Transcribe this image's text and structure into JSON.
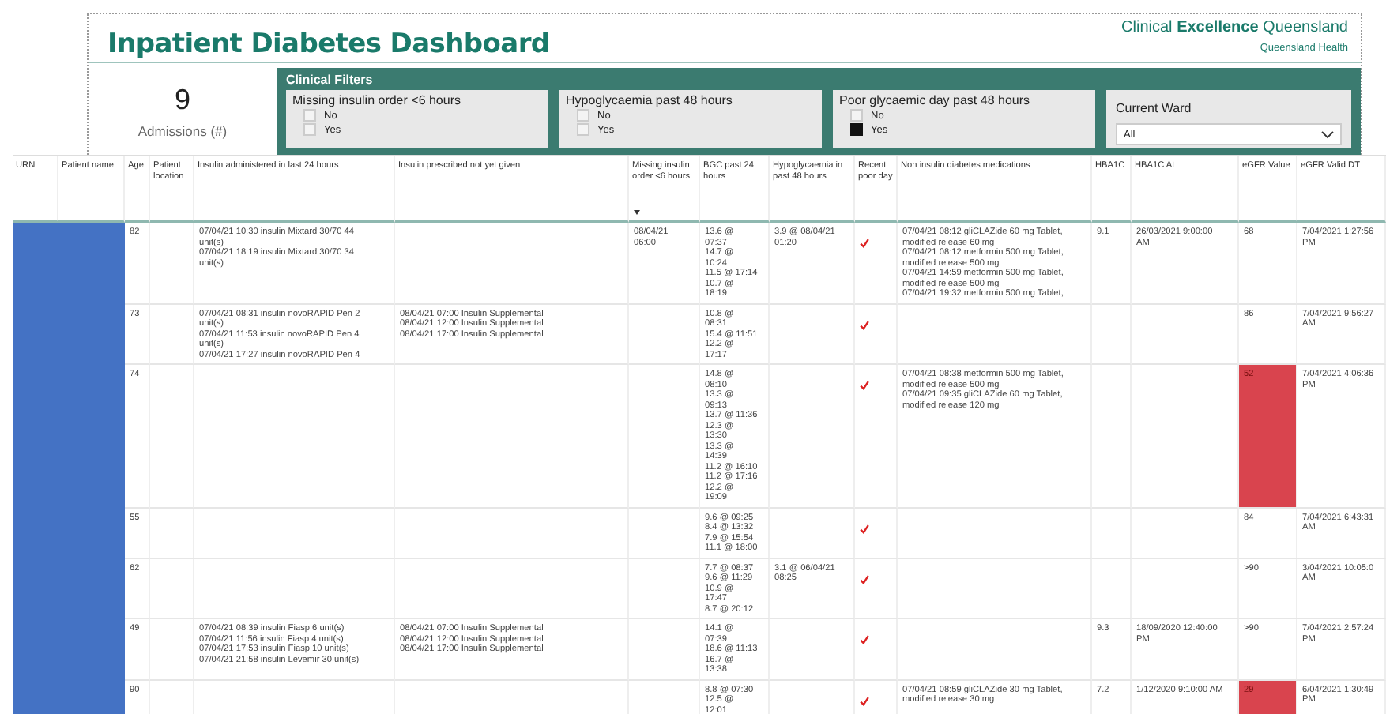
{
  "header": {
    "title": "Inpatient Diabetes Dashboard",
    "brand": "Clinical **Excellence** Queensland",
    "brand_sub": "Queensland Health"
  },
  "admissions": {
    "value": "9",
    "label": "Admissions (#)"
  },
  "filters": {
    "title": "Clinical Filters",
    "slicers": [
      {
        "kind": "checklist",
        "title": "Missing insulin order <6 hours",
        "options": [
          {
            "label": "No",
            "checked": false
          },
          {
            "label": "Yes",
            "checked": false
          }
        ]
      },
      {
        "kind": "checklist",
        "title": "Hypoglycaemia past 48 hours",
        "options": [
          {
            "label": "No",
            "checked": false
          },
          {
            "label": "Yes",
            "checked": false
          }
        ]
      },
      {
        "kind": "checklist",
        "title": "Poor glycaemic day past 48 hours",
        "options": [
          {
            "label": "No",
            "checked": false
          },
          {
            "label": "Yes",
            "checked": true
          }
        ]
      },
      {
        "kind": "dropdown",
        "title": "Current Ward",
        "value": "All"
      }
    ]
  },
  "table": {
    "columns": [
      {
        "label": "URN"
      },
      {
        "label": "Patient name"
      },
      {
        "label": "Age"
      },
      {
        "label": "Patient location"
      },
      {
        "label": "Insulin administered in last 24 hours"
      },
      {
        "label": "Insulin prescribed not yet given"
      },
      {
        "label": "Missing insulin order <6 hours",
        "sorted": true
      },
      {
        "label": "BGC past 24 hours"
      },
      {
        "label": "Hypoglycaemia in past 48 hours"
      },
      {
        "label": "Recent poor day"
      },
      {
        "label": "Non insulin diabetes medications"
      },
      {
        "label": "HBA1C"
      },
      {
        "label": "HBA1C At"
      },
      {
        "label": "eGFR Value"
      },
      {
        "label": "eGFR Valid DT"
      }
    ],
    "rows": [
      {
        "cells": [
          {
            "kind": "redacted"
          },
          {
            "kind": "redacted"
          },
          {
            "kind": "text",
            "lines": [
              "82"
            ]
          },
          {
            "kind": "text"
          },
          {
            "kind": "text",
            "lines": [
              "07/04/21 10:30 insulin Mixtard 30/70 44",
              "unit(s)",
              "07/04/21 18:19 insulin Mixtard 30/70 34",
              "unit(s)"
            ]
          },
          {
            "kind": "text"
          },
          {
            "kind": "text",
            "lines": [
              "08/04/21",
              "06:00"
            ]
          },
          {
            "kind": "text",
            "lines": [
              "13.6 @",
              "07:37",
              "14.7 @",
              "10:24",
              "11.5 @ 17:14",
              "10.7 @",
              "18:19"
            ]
          },
          {
            "kind": "text",
            "lines": [
              "3.9 @ 08/04/21",
              "01:20"
            ]
          },
          {
            "kind": "check",
            "checked": true
          },
          {
            "kind": "text",
            "lines": [
              "07/04/21 08:12 gliCLAZide 60 mg Tablet,",
              "modified release 60 mg",
              "07/04/21 08:12 metformin 500 mg Tablet,",
              "modified release 500 mg",
              "07/04/21 14:59 metformin 500 mg Tablet,",
              "modified release 500 mg",
              "07/04/21 19:32 metformin 500 mg Tablet,"
            ]
          },
          {
            "kind": "text",
            "lines": [
              "9.1"
            ]
          },
          {
            "kind": "text",
            "lines": [
              "26/03/2021 9:00:00",
              "AM"
            ]
          },
          {
            "kind": "flag",
            "low": false,
            "lines": [
              "68"
            ]
          },
          {
            "kind": "text",
            "lines": [
              "7/04/2021 1:27:56",
              "PM"
            ]
          }
        ]
      },
      {
        "cells": [
          {
            "kind": "redacted"
          },
          {
            "kind": "redacted"
          },
          {
            "kind": "text",
            "lines": [
              "73"
            ]
          },
          {
            "kind": "text"
          },
          {
            "kind": "text",
            "lines": [
              "07/04/21 08:31 insulin novoRAPID Pen 2",
              "unit(s)",
              "07/04/21 11:53 insulin novoRAPID Pen 4",
              "unit(s)",
              "07/04/21 17:27 insulin novoRAPID Pen 4"
            ]
          },
          {
            "kind": "text",
            "lines": [
              "08/04/21 07:00 Insulin Supplemental",
              "08/04/21 12:00 Insulin Supplemental",
              "08/04/21 17:00 Insulin Supplemental"
            ]
          },
          {
            "kind": "text"
          },
          {
            "kind": "text",
            "lines": [
              "10.8 @",
              "08:31",
              "15.4 @ 11:51",
              "12.2 @",
              "17:17"
            ]
          },
          {
            "kind": "text"
          },
          {
            "kind": "check",
            "checked": true
          },
          {
            "kind": "text"
          },
          {
            "kind": "text"
          },
          {
            "kind": "text"
          },
          {
            "kind": "flag",
            "low": false,
            "lines": [
              "86"
            ]
          },
          {
            "kind": "text",
            "lines": [
              "7/04/2021 9:56:27",
              "AM"
            ]
          }
        ]
      },
      {
        "cells": [
          {
            "kind": "redacted"
          },
          {
            "kind": "redacted"
          },
          {
            "kind": "text",
            "lines": [
              "74"
            ]
          },
          {
            "kind": "text"
          },
          {
            "kind": "text"
          },
          {
            "kind": "text"
          },
          {
            "kind": "text"
          },
          {
            "kind": "text",
            "lines": [
              "14.8 @",
              "08:10",
              "13.3 @",
              "09:13",
              "13.7 @ 11:36",
              "12.3 @",
              "13:30",
              "13.3 @",
              "14:39",
              "11.2 @ 16:10",
              "11.2 @ 17:16",
              "12.2 @",
              "19:09"
            ]
          },
          {
            "kind": "text"
          },
          {
            "kind": "check",
            "checked": true
          },
          {
            "kind": "text",
            "lines": [
              "07/04/21 08:38 metformin 500 mg Tablet,",
              "modified release 500 mg",
              "07/04/21 09:35 gliCLAZide 60 mg Tablet,",
              "modified release 120 mg"
            ]
          },
          {
            "kind": "text"
          },
          {
            "kind": "text"
          },
          {
            "kind": "flag",
            "low": true,
            "lines": [
              "52"
            ]
          },
          {
            "kind": "text",
            "lines": [
              "7/04/2021 4:06:36",
              "PM"
            ]
          }
        ]
      },
      {
        "cells": [
          {
            "kind": "redacted"
          },
          {
            "kind": "redacted"
          },
          {
            "kind": "text",
            "lines": [
              "55"
            ]
          },
          {
            "kind": "text"
          },
          {
            "kind": "text"
          },
          {
            "kind": "text"
          },
          {
            "kind": "text"
          },
          {
            "kind": "text",
            "lines": [
              "9.6 @ 09:25",
              "8.4 @ 13:32",
              "7.9 @ 15:54",
              "11.1 @ 18:00"
            ]
          },
          {
            "kind": "text"
          },
          {
            "kind": "check",
            "checked": true
          },
          {
            "kind": "text"
          },
          {
            "kind": "text"
          },
          {
            "kind": "text"
          },
          {
            "kind": "flag",
            "low": false,
            "lines": [
              "84"
            ]
          },
          {
            "kind": "text",
            "lines": [
              "7/04/2021 6:43:31",
              "AM"
            ]
          }
        ]
      },
      {
        "cells": [
          {
            "kind": "redacted"
          },
          {
            "kind": "redacted"
          },
          {
            "kind": "text",
            "lines": [
              "62"
            ]
          },
          {
            "kind": "text"
          },
          {
            "kind": "text"
          },
          {
            "kind": "text"
          },
          {
            "kind": "text"
          },
          {
            "kind": "text",
            "lines": [
              "7.7 @ 08:37",
              "9.6 @ 11:29",
              "10.9 @",
              "17:47",
              "8.7 @ 20:12"
            ]
          },
          {
            "kind": "text",
            "lines": [
              "3.1 @ 06/04/21",
              "08:25"
            ]
          },
          {
            "kind": "check",
            "checked": true
          },
          {
            "kind": "text"
          },
          {
            "kind": "text"
          },
          {
            "kind": "text"
          },
          {
            "kind": "flag",
            "low": false,
            "lines": [
              ">90"
            ]
          },
          {
            "kind": "text",
            "lines": [
              "3/04/2021 10:05:0",
              "AM"
            ]
          }
        ]
      },
      {
        "cells": [
          {
            "kind": "redacted"
          },
          {
            "kind": "redacted"
          },
          {
            "kind": "text",
            "lines": [
              "49"
            ]
          },
          {
            "kind": "text"
          },
          {
            "kind": "text",
            "lines": [
              "07/04/21 08:39 insulin Fiasp 6 unit(s)",
              "07/04/21 11:56 insulin Fiasp 4 unit(s)",
              "07/04/21 17:53 insulin Fiasp 10 unit(s)",
              "07/04/21 21:58 insulin Levemir 30 unit(s)"
            ]
          },
          {
            "kind": "text",
            "lines": [
              "08/04/21 07:00 Insulin Supplemental",
              "08/04/21 12:00 Insulin Supplemental",
              "08/04/21 17:00 Insulin Supplemental"
            ]
          },
          {
            "kind": "text"
          },
          {
            "kind": "text",
            "lines": [
              "14.1 @",
              "07:39",
              "18.6 @ 11:13",
              "16.7 @",
              "13:38"
            ]
          },
          {
            "kind": "text"
          },
          {
            "kind": "check",
            "checked": true
          },
          {
            "kind": "text"
          },
          {
            "kind": "text",
            "lines": [
              "9.3"
            ]
          },
          {
            "kind": "text",
            "lines": [
              "18/09/2020 12:40:00",
              "PM"
            ]
          },
          {
            "kind": "flag",
            "low": false,
            "lines": [
              ">90"
            ]
          },
          {
            "kind": "text",
            "lines": [
              "7/04/2021 2:57:24",
              "PM"
            ]
          }
        ]
      },
      {
        "cells": [
          {
            "kind": "redacted"
          },
          {
            "kind": "redacted"
          },
          {
            "kind": "text",
            "lines": [
              "90"
            ]
          },
          {
            "kind": "text"
          },
          {
            "kind": "text"
          },
          {
            "kind": "text"
          },
          {
            "kind": "text"
          },
          {
            "kind": "text",
            "lines": [
              "8.8 @ 07:30",
              "12.5 @",
              "12:01"
            ]
          },
          {
            "kind": "text"
          },
          {
            "kind": "check",
            "checked": true
          },
          {
            "kind": "text",
            "lines": [
              "07/04/21 08:59 gliCLAZide 30 mg Tablet,",
              "modified release 30 mg"
            ]
          },
          {
            "kind": "text",
            "lines": [
              "7.2"
            ]
          },
          {
            "kind": "text",
            "lines": [
              "1/12/2020 9:10:00 AM"
            ]
          },
          {
            "kind": "flag",
            "low": true,
            "lines": [
              "29"
            ]
          },
          {
            "kind": "text",
            "lines": [
              "6/04/2021 1:30:49",
              "PM"
            ]
          }
        ]
      }
    ]
  }
}
